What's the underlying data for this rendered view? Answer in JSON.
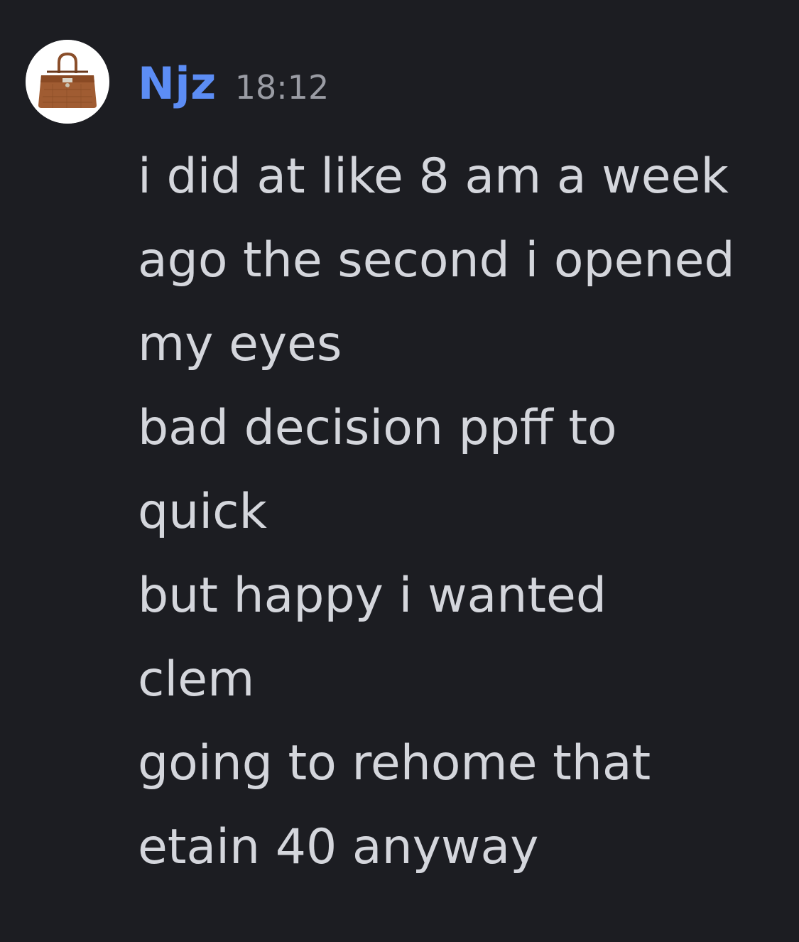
{
  "message": {
    "author": "Njz",
    "time": "18:12",
    "author_color": "#5c8df5",
    "avatar_icon": "handbag-icon",
    "lines": [
      "i did at like 8 am a week",
      "ago the second i opened",
      "my eyes",
      "bad decision ppff to",
      "quick",
      "but happy i wanted",
      "clem",
      "going to rehome that",
      "etain 40 anyway"
    ]
  }
}
